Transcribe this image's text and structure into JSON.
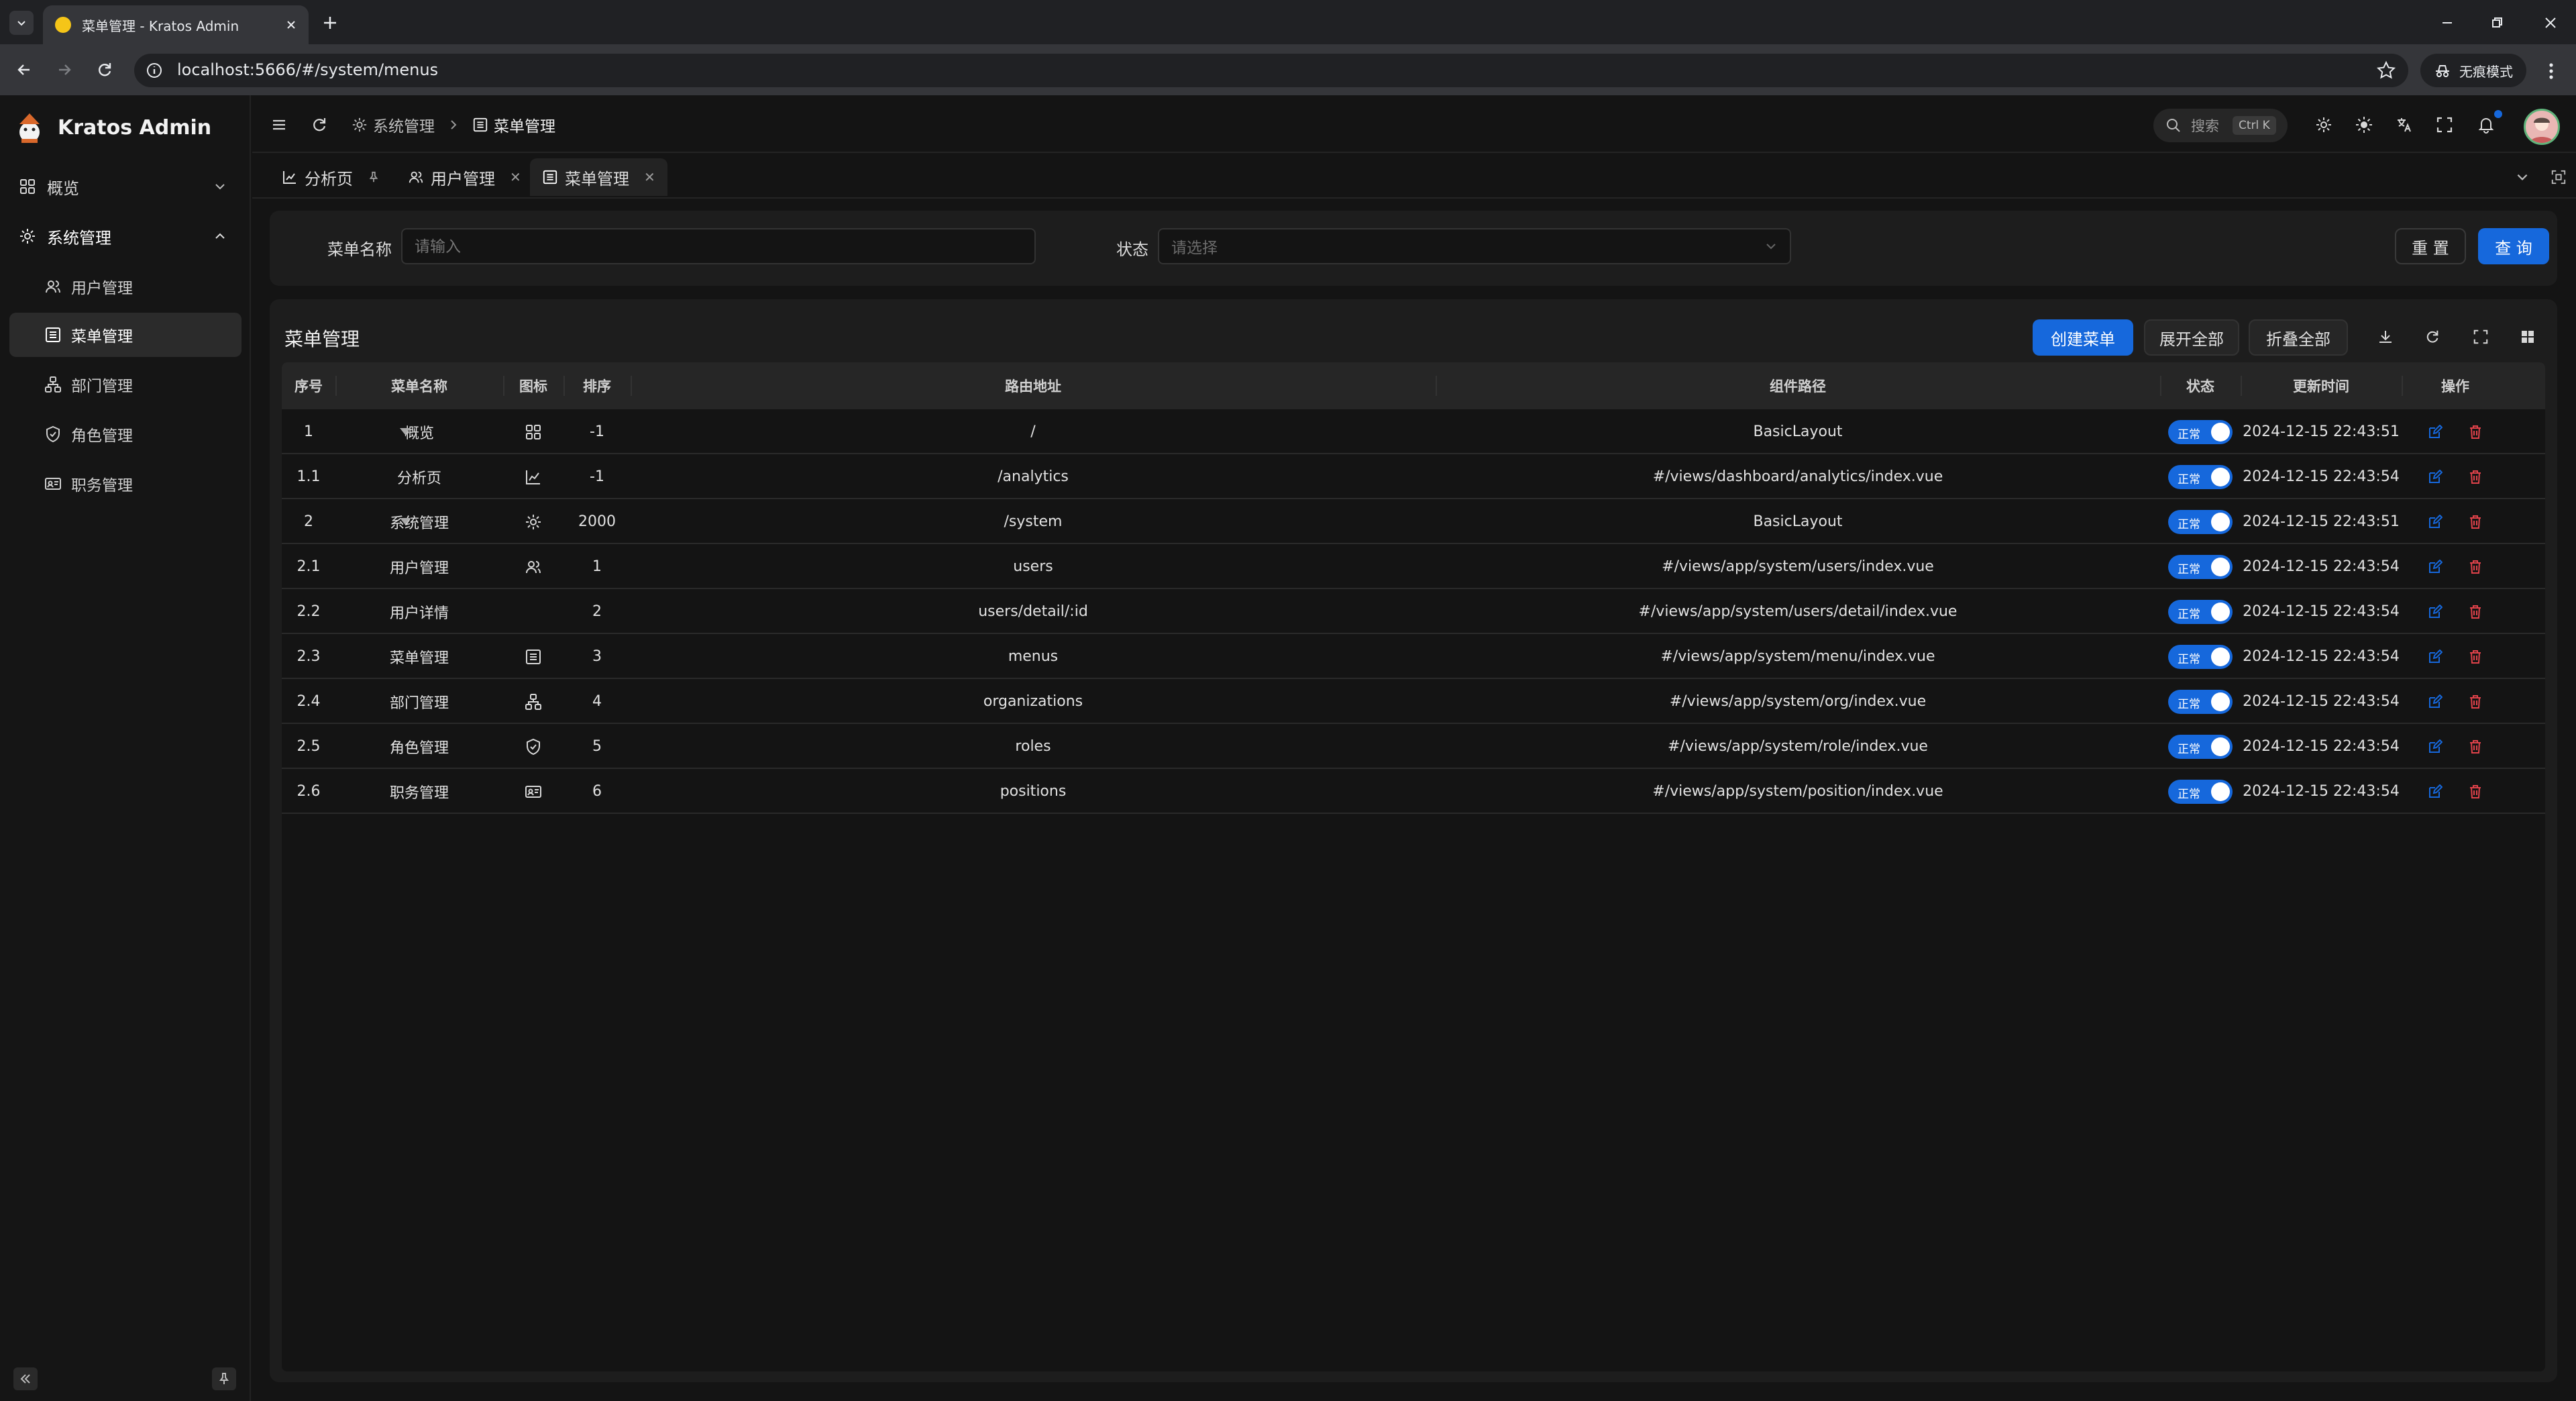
{
  "browser": {
    "tab_title": "菜单管理 - Kratos Admin",
    "url": "localhost:5666/#/system/menus",
    "incognito_label": "无痕模式"
  },
  "app": {
    "name": "Kratos Admin"
  },
  "sidebar": {
    "groups": [
      {
        "label": "概览",
        "icon": "dashboard-icon",
        "expanded": false
      },
      {
        "label": "系统管理",
        "icon": "gear-icon",
        "expanded": true
      }
    ],
    "items": [
      {
        "label": "用户管理",
        "icon": "users-icon"
      },
      {
        "label": "菜单管理",
        "icon": "list-icon",
        "active": true
      },
      {
        "label": "部门管理",
        "icon": "org-tree-icon"
      },
      {
        "label": "角色管理",
        "icon": "shield-icon"
      },
      {
        "label": "职务管理",
        "icon": "id-card-icon"
      }
    ]
  },
  "header": {
    "breadcrumb": [
      "系统管理",
      "菜单管理"
    ],
    "search_placeholder": "搜索",
    "search_shortcut": "Ctrl K"
  },
  "page_tabs": [
    {
      "label": "分析页",
      "icon": "chart-icon",
      "pinned": true
    },
    {
      "label": "用户管理",
      "icon": "users-icon",
      "closable": true
    },
    {
      "label": "菜单管理",
      "icon": "list-icon",
      "closable": true,
      "active": true
    }
  ],
  "search_form": {
    "name_label": "菜单名称",
    "name_placeholder": "请输入",
    "status_label": "状态",
    "status_placeholder": "请选择",
    "reset_label": "重 置",
    "query_label": "查 询"
  },
  "table": {
    "title": "菜单管理",
    "create_label": "创建菜单",
    "expand_all_label": "展开全部",
    "collapse_all_label": "折叠全部",
    "columns": [
      "序号",
      "菜单名称",
      "图标",
      "排序",
      "路由地址",
      "组件路径",
      "状态",
      "更新时间",
      "操作"
    ],
    "rows": [
      {
        "seq": "1",
        "name": "概览",
        "icon": "dashboard-icon",
        "order": "-1",
        "path": "/",
        "component": "BasicLayout",
        "status": "正常",
        "updated": "2024-12-15 22:43:51",
        "expandable": true
      },
      {
        "seq": "1.1",
        "name": "分析页",
        "icon": "chart-icon",
        "order": "-1",
        "path": "/analytics",
        "component": "#/views/dashboard/analytics/index.vue",
        "status": "正常",
        "updated": "2024-12-15 22:43:54"
      },
      {
        "seq": "2",
        "name": "系统管理",
        "icon": "gear-icon",
        "order": "2000",
        "path": "/system",
        "component": "BasicLayout",
        "status": "正常",
        "updated": "2024-12-15 22:43:51",
        "expandable": true
      },
      {
        "seq": "2.1",
        "name": "用户管理",
        "icon": "users-icon",
        "order": "1",
        "path": "users",
        "component": "#/views/app/system/users/index.vue",
        "status": "正常",
        "updated": "2024-12-15 22:43:54"
      },
      {
        "seq": "2.2",
        "name": "用户详情",
        "icon": "",
        "order": "2",
        "path": "users/detail/:id",
        "component": "#/views/app/system/users/detail/index.vue",
        "status": "正常",
        "updated": "2024-12-15 22:43:54"
      },
      {
        "seq": "2.3",
        "name": "菜单管理",
        "icon": "list-icon",
        "order": "3",
        "path": "menus",
        "component": "#/views/app/system/menu/index.vue",
        "status": "正常",
        "updated": "2024-12-15 22:43:54"
      },
      {
        "seq": "2.4",
        "name": "部门管理",
        "icon": "org-tree-icon",
        "order": "4",
        "path": "organizations",
        "component": "#/views/app/system/org/index.vue",
        "status": "正常",
        "updated": "2024-12-15 22:43:54"
      },
      {
        "seq": "2.5",
        "name": "角色管理",
        "icon": "shield-icon",
        "order": "5",
        "path": "roles",
        "component": "#/views/app/system/role/index.vue",
        "status": "正常",
        "updated": "2024-12-15 22:43:54"
      },
      {
        "seq": "2.6",
        "name": "职务管理",
        "icon": "id-card-icon",
        "order": "6",
        "path": "positions",
        "component": "#/views/app/system/position/index.vue",
        "status": "正常",
        "updated": "2024-12-15 22:43:54"
      }
    ]
  },
  "colors": {
    "primary": "#1668dc",
    "danger": "#e0424a",
    "background": "#141414",
    "panel": "#1d1d1d"
  }
}
